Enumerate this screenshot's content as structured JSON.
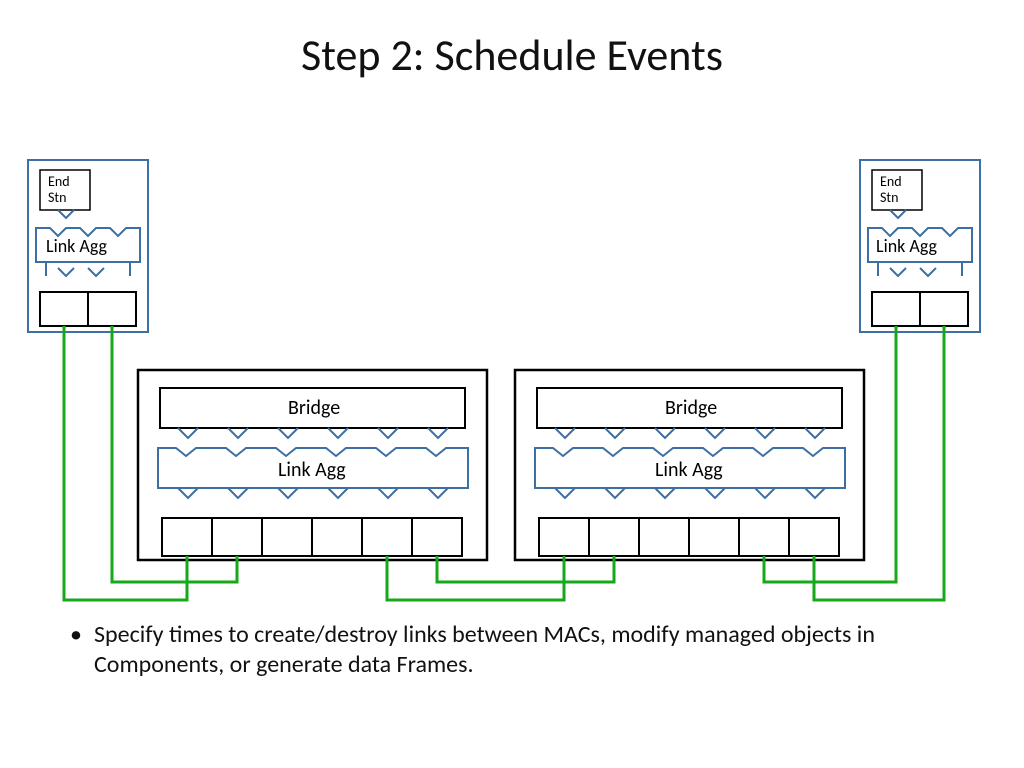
{
  "title": "Step 2:  Schedule Events",
  "bullet": "Specify times to create/destroy links between MACs, modify managed objects in Components, or generate data Frames.",
  "labels": {
    "end_stn": "End\nStn",
    "link_agg": "Link Agg",
    "bridge": "Bridge"
  },
  "colors": {
    "boxBlue": "#3e6fa3",
    "boxBlack": "#000000",
    "linkGreen": "#17a81a"
  }
}
